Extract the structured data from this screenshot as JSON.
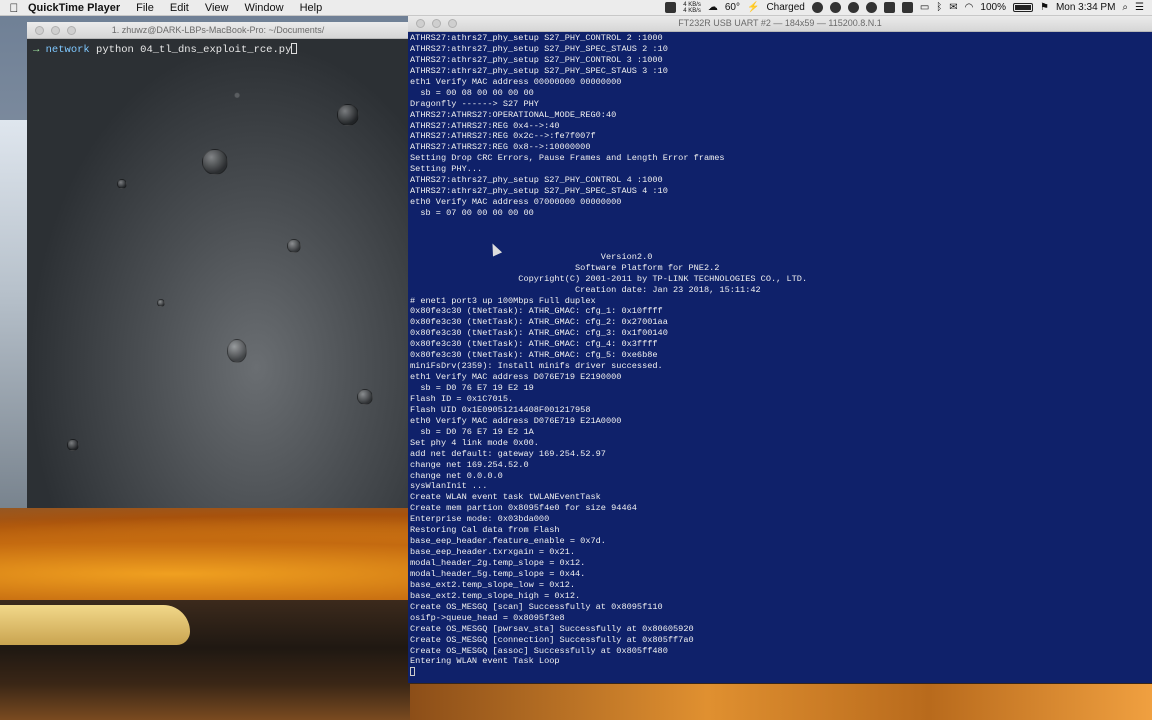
{
  "menubar": {
    "app_name": "QuickTime Player",
    "menus": [
      "File",
      "Edit",
      "View",
      "Window",
      "Help"
    ],
    "net_up": "4 KB/s",
    "net_down": "4 KB/s",
    "temp": "60°",
    "power": "Charged",
    "battery_pct": "100%",
    "clock": "Mon 3:34 PM"
  },
  "left_terminal": {
    "title": "1. zhuwz@DARK-LBPs-MacBook-Pro: ~/Documents/",
    "prompt_arrow": "→",
    "prompt_dir": "network",
    "command": "python 04_tl_dns_exploit_rce.py"
  },
  "right_terminal": {
    "title": "FT232R USB UART #2 — 184x59 — 115200.8.N.1",
    "lines": [
      "ATHRS27:athrs27_phy_setup S27_PHY_CONTROL 2 :1000",
      "ATHRS27:athrs27_phy_setup S27_PHY_SPEC_STAUS 2 :10",
      "ATHRS27:athrs27_phy_setup S27_PHY_CONTROL 3 :1000",
      "ATHRS27:athrs27_phy_setup S27_PHY_SPEC_STAUS 3 :10",
      "eth1 Verify MAC address 00000000 00000000",
      "  sb = 00 08 00 00 00 00",
      "Dragonfly ------> S27 PHY",
      "ATHRS27:ATHRS27:OPERATIONAL_MODE_REG0:40",
      "ATHRS27:ATHRS27:REG 0x4-->:40",
      "ATHRS27:ATHRS27:REG 0x2c-->:fe7f007f",
      "ATHRS27:ATHRS27:REG 0x8-->:10000000",
      "Setting Drop CRC Errors, Pause Frames and Length Error frames",
      "Setting PHY...",
      "ATHRS27:athrs27_phy_setup S27_PHY_CONTROL 4 :1000",
      "ATHRS27:athrs27_phy_setup S27_PHY_SPEC_STAUS 4 :10",
      "eth0 Verify MAC address 07000000 00000000",
      "  sb = 07 00 00 00 00 00",
      "",
      "",
      "",
      "                                     Version2.0",
      "                                Software Platform for PNE2.2",
      "                     Copyright(C) 2001-2011 by TP-LINK TECHNOLOGIES CO., LTD.",
      "                                Creation date: Jan 23 2018, 15:11:42",
      "# enet1 port3 up 100Mbps Full duplex",
      "0x80fe3c30 (tNetTask): ATHR_GMAC: cfg_1: 0x10ffff",
      "0x80fe3c30 (tNetTask): ATHR_GMAC: cfg_2: 0x27001aa",
      "0x80fe3c30 (tNetTask): ATHR_GMAC: cfg_3: 0x1f00140",
      "0x80fe3c30 (tNetTask): ATHR_GMAC: cfg_4: 0x3ffff",
      "0x80fe3c30 (tNetTask): ATHR_GMAC: cfg_5: 0xe6b8e",
      "miniFsDrv(2359): Install minifs driver successed.",
      "eth1 Verify MAC address D076E719 E2190000",
      "  sb = D0 76 E7 19 E2 19",
      "Flash ID = 0x1C7015.",
      "Flash UID 0x1E09051214408F001217958",
      "eth0 Verify MAC address D076E719 E21A0000",
      "  sb = D0 76 E7 19 E2 1A",
      "Set phy 4 link mode 0x00.",
      "add net default: gateway 169.254.52.97",
      "change net 169.254.52.0",
      "change net 0.0.0.0",
      "sysWlanInit ...",
      "Create WLAN event task tWLANEventTask",
      "Create mem partion 0x8095f4e0 for size 94464",
      "Enterprise mode: 0x03bda000",
      "Restoring Cal data from Flash",
      "base_eep_header.feature_enable = 0x7d.",
      "base_eep_header.txrxgain = 0x21.",
      "modal_header_2g.temp_slope = 0x12.",
      "modal_header_5g.temp_slope = 0x44.",
      "base_ext2.temp_slope_low = 0x12.",
      "base_ext2.temp_slope_high = 0x12.",
      "Create OS_MESGQ [scan] Successfully at 0x8095f110",
      "osifp->queue_head = 0x8095f3e8",
      "Create OS_MESGQ [pwrsav_sta] Successfully at 0x80605920",
      "Create OS_MESGQ [connection] Successfully at 0x805ff7a0",
      "Create OS_MESGQ [assoc] Successfully at 0x805ff480",
      "Entering WLAN event Task Loop"
    ]
  }
}
